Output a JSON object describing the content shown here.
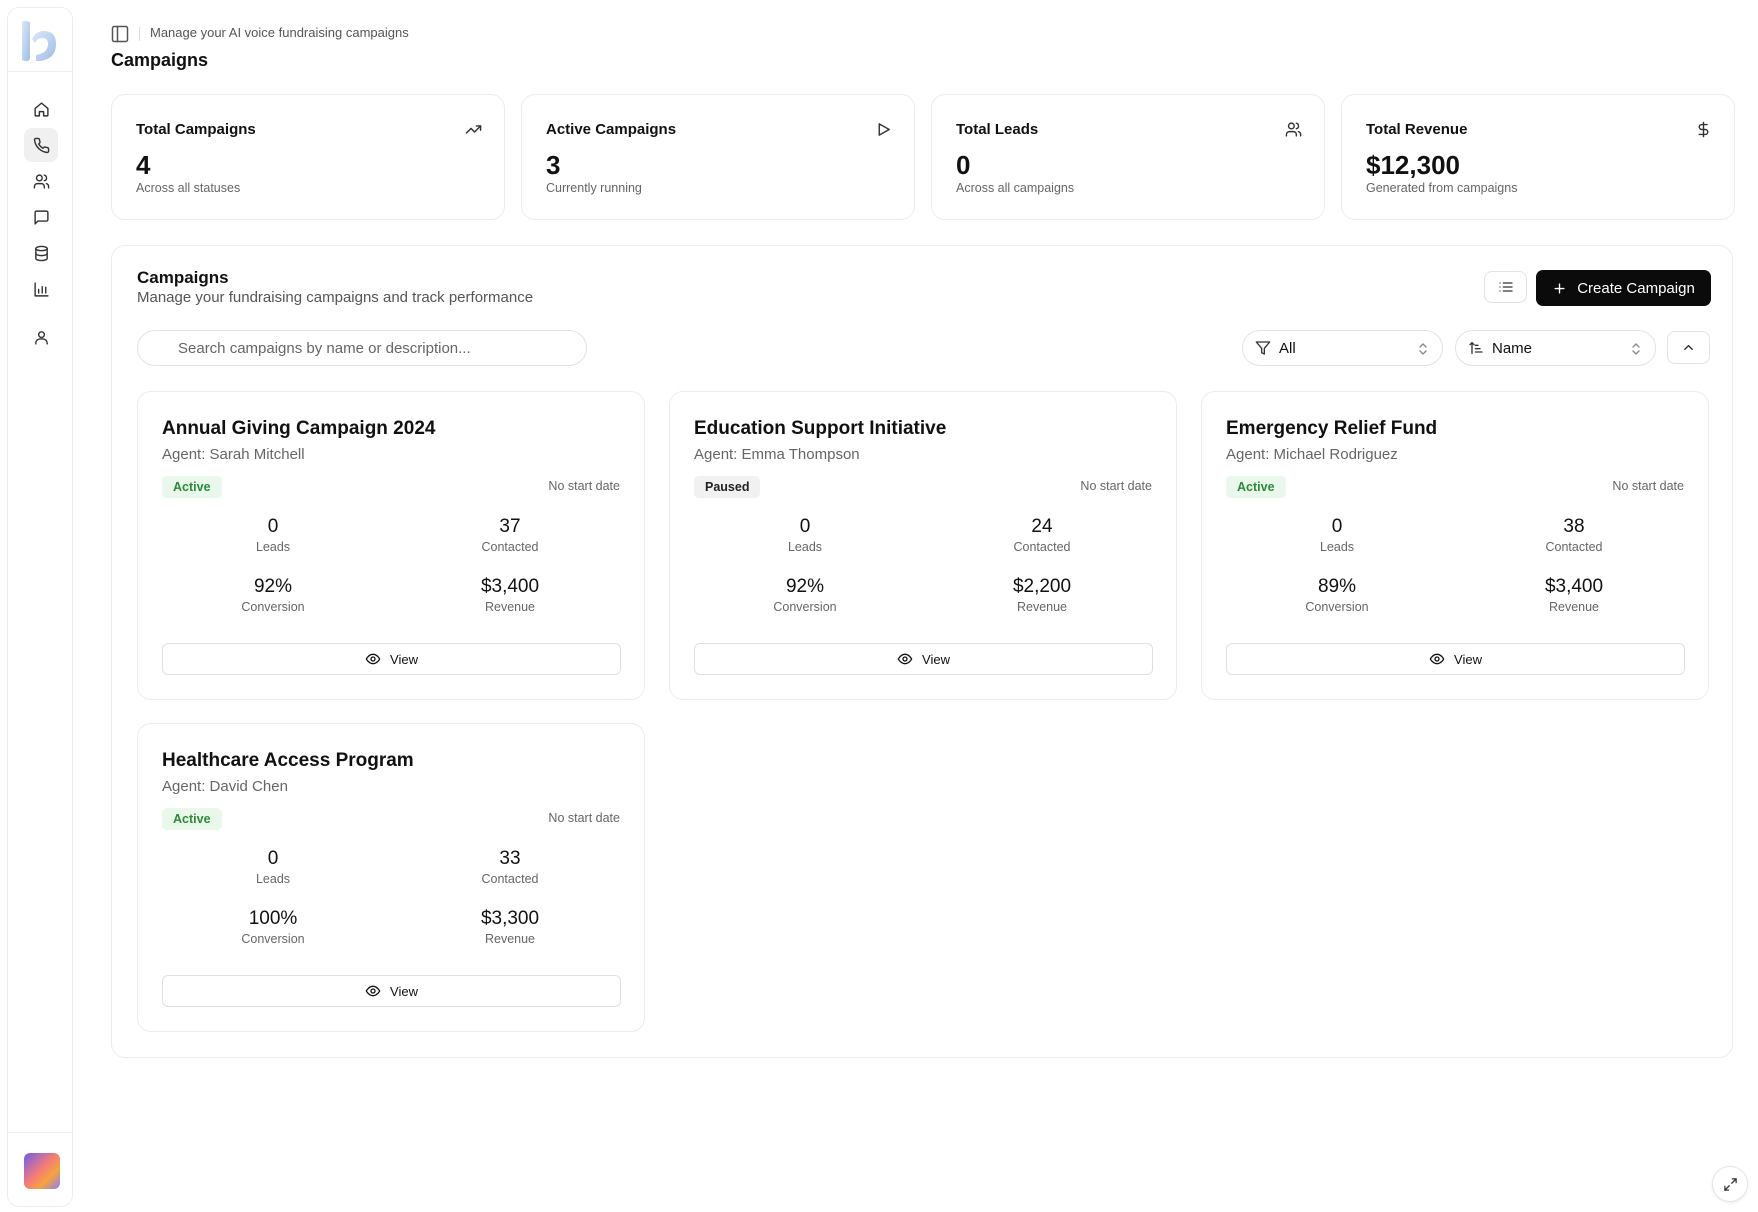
{
  "header": {
    "subtitle": "Manage your AI voice fundraising campaigns",
    "title": "Campaigns"
  },
  "sidebar": {
    "items": [
      {
        "icon": "home-icon",
        "active": false
      },
      {
        "icon": "phone-icon",
        "active": true
      },
      {
        "icon": "users-icon",
        "active": false
      },
      {
        "icon": "message-icon",
        "active": false
      },
      {
        "icon": "database-icon",
        "active": false
      },
      {
        "icon": "bar-chart-icon",
        "active": false
      },
      {
        "icon": "user-icon",
        "active": false
      }
    ]
  },
  "stats": [
    {
      "title": "Total Campaigns",
      "value": "4",
      "sub": "Across all statuses",
      "icon": "trending-up-icon"
    },
    {
      "title": "Active Campaigns",
      "value": "3",
      "sub": "Currently running",
      "icon": "play-icon"
    },
    {
      "title": "Total Leads",
      "value": "0",
      "sub": "Across all campaigns",
      "icon": "users-icon"
    },
    {
      "title": "Total Revenue",
      "value": "$12,300",
      "sub": "Generated from campaigns",
      "icon": "dollar-icon"
    }
  ],
  "panel": {
    "title": "Campaigns",
    "subtitle": "Manage your fundraising campaigns and track performance",
    "create_label": "Create Campaign",
    "search_placeholder": "Search campaigns by name or description...",
    "filter_value": "All",
    "sort_value": "Name"
  },
  "campaigns": [
    {
      "name": "Annual Giving Campaign 2024",
      "agent": "Agent: Sarah Mitchell",
      "status": "Active",
      "date": "No start date",
      "leads": "0",
      "leads_label": "Leads",
      "contacted": "37",
      "contacted_label": "Contacted",
      "conversion": "92%",
      "conversion_label": "Conversion",
      "revenue": "$3,400",
      "revenue_label": "Revenue",
      "view_label": "View"
    },
    {
      "name": "Education Support Initiative",
      "agent": "Agent: Emma Thompson",
      "status": "Paused",
      "date": "No start date",
      "leads": "0",
      "leads_label": "Leads",
      "contacted": "24",
      "contacted_label": "Contacted",
      "conversion": "92%",
      "conversion_label": "Conversion",
      "revenue": "$2,200",
      "revenue_label": "Revenue",
      "view_label": "View"
    },
    {
      "name": "Emergency Relief Fund",
      "agent": "Agent: Michael Rodriguez",
      "status": "Active",
      "date": "No start date",
      "leads": "0",
      "leads_label": "Leads",
      "contacted": "38",
      "contacted_label": "Contacted",
      "conversion": "89%",
      "conversion_label": "Conversion",
      "revenue": "$3,400",
      "revenue_label": "Revenue",
      "view_label": "View"
    },
    {
      "name": "Healthcare Access Program",
      "agent": "Agent: David Chen",
      "status": "Active",
      "date": "No start date",
      "leads": "0",
      "leads_label": "Leads",
      "contacted": "33",
      "contacted_label": "Contacted",
      "conversion": "100%",
      "conversion_label": "Conversion",
      "revenue": "$3,300",
      "revenue_label": "Revenue",
      "view_label": "View"
    }
  ],
  "colors": {
    "primary_button": "#0b0b0b",
    "active_badge_bg": "#eaf8ec",
    "active_badge_text": "#2c8a3a",
    "paused_badge_bg": "#f1f1f1"
  }
}
